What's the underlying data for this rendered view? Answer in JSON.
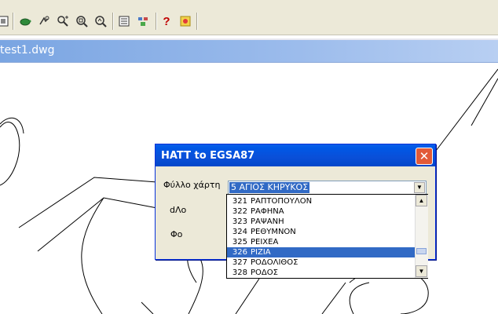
{
  "toolbar": {
    "icons": [
      "pan-icon",
      "turtle-icon",
      "zoom-realtime-icon",
      "zoom-in-icon",
      "zoom-window-icon",
      "zoom-previous-icon",
      "properties-icon",
      "design-center-icon",
      "help-icon",
      "tool-palette-icon"
    ],
    "help_glyph": "?"
  },
  "document": {
    "title": "test1.dwg"
  },
  "dialog": {
    "title": "HATT to EGSA87",
    "close_glyph": "✕",
    "fields": {
      "sheet_label": "Φύλλο χάρτη",
      "dlo_label": "dΛo",
      "fo_label": "Φo"
    },
    "combo": {
      "selected": "5  ΑΓΙΟΣ ΚΗΡΥΚΟΣ",
      "arrow": "▼"
    }
  },
  "dropdown": {
    "items": [
      {
        "num": "321",
        "name": "ΡΑΠΤΟΠΟΥΛΟΝ"
      },
      {
        "num": "322",
        "name": "ΡΑΦΗΝΑ"
      },
      {
        "num": "323",
        "name": "ΡΑΨΑΝΗ"
      },
      {
        "num": "324",
        "name": "ΡΕΘΥΜΝΟΝ"
      },
      {
        "num": "325",
        "name": "ΡΕΙΧΕΑ"
      },
      {
        "num": "326",
        "name": "ΡΙΖΙΑ"
      },
      {
        "num": "327",
        "name": "ΡΟΔΟΛΙΘΟΣ"
      },
      {
        "num": "328",
        "name": "ΡΟΔΟΣ"
      }
    ],
    "selected_index": 5
  }
}
